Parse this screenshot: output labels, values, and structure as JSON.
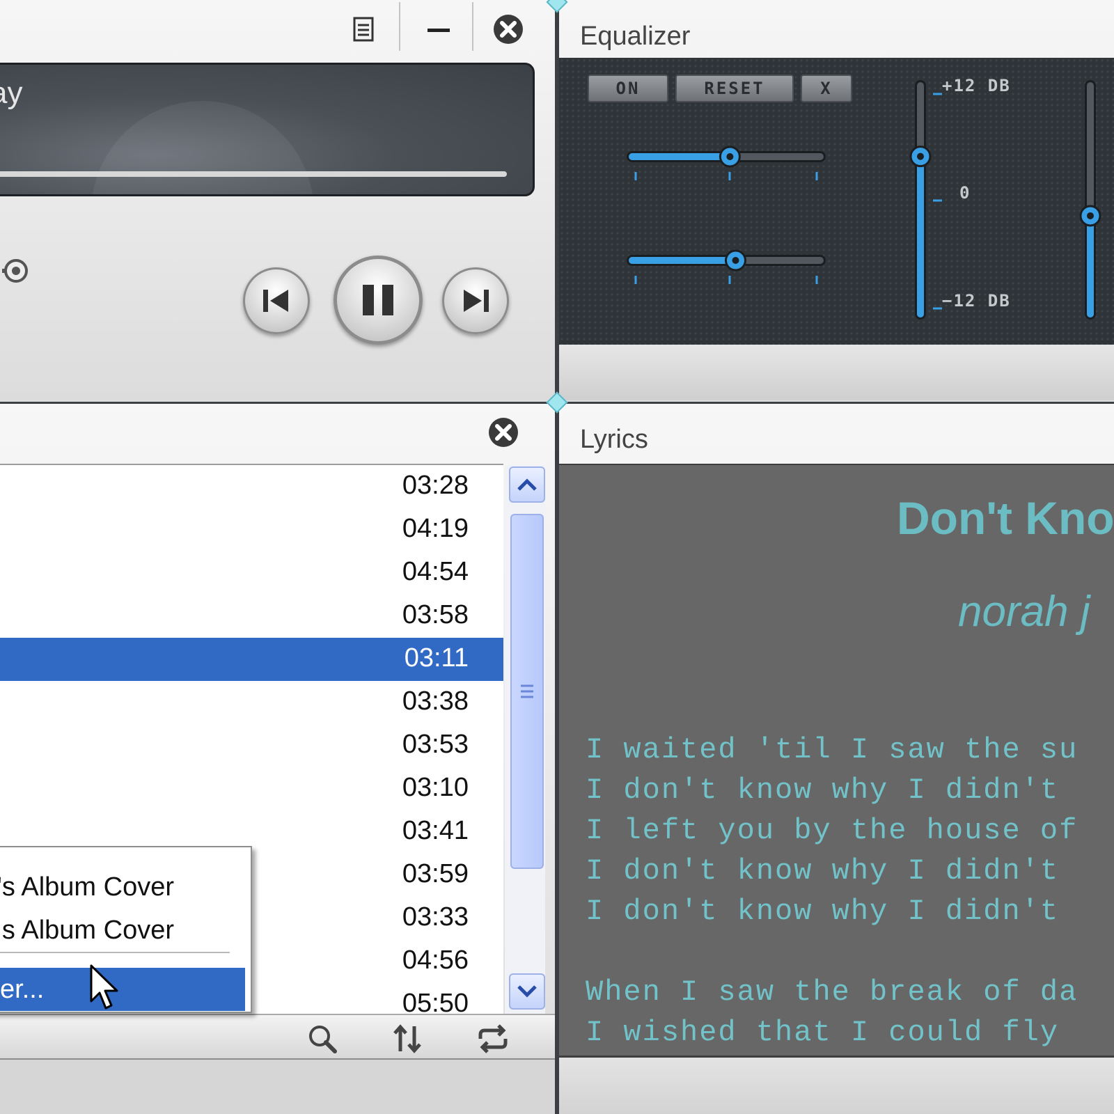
{
  "player": {
    "track_title": "ay",
    "progress": 0.97,
    "icons": {
      "notes": "document-icon",
      "minimize": "minimize-icon",
      "close": "close-icon",
      "volume": "volume-knob-icon",
      "prev": "previous-track-icon",
      "pause": "pause-icon",
      "next": "next-track-icon"
    }
  },
  "equalizer": {
    "title": "Equalizer",
    "buttons": {
      "on": "ON",
      "reset": "RESET",
      "close": "X"
    },
    "db_labels": {
      "top": "+12 DB",
      "mid": "0",
      "bottom": "−12 DB"
    },
    "horizontal_sliders": [
      0.52,
      0.55
    ],
    "band_levels": [
      0.69,
      0.43
    ],
    "accent_color": "#3aa0e6"
  },
  "playlist": {
    "durations": [
      "03:28",
      "04:19",
      "04:54",
      "03:58",
      "03:11",
      "03:38",
      "03:53",
      "03:10",
      "03:41",
      "03:59",
      "03:33",
      "04:56",
      "05:50"
    ],
    "selected_index": 4,
    "selection_color": "#316ac5",
    "toolbar_icons": [
      "search-icon",
      "sort-icon",
      "repeat-icon"
    ]
  },
  "context_menu": {
    "items": [
      "n's Album Cover",
      "s Album Cover",
      "er..."
    ],
    "highlighted_index": 2
  },
  "lyrics": {
    "title": "Lyrics",
    "song_title": "Don't Kno",
    "artist": "norah j",
    "lines": [
      "I waited 'til I saw the su",
      "I don't know why I didn't",
      "I left you by the house of",
      "I don't know why I didn't",
      "I don't know why I didn't",
      "",
      "When I saw the break of da",
      "I wished that I could fly"
    ],
    "text_color": "#72c3c9"
  }
}
